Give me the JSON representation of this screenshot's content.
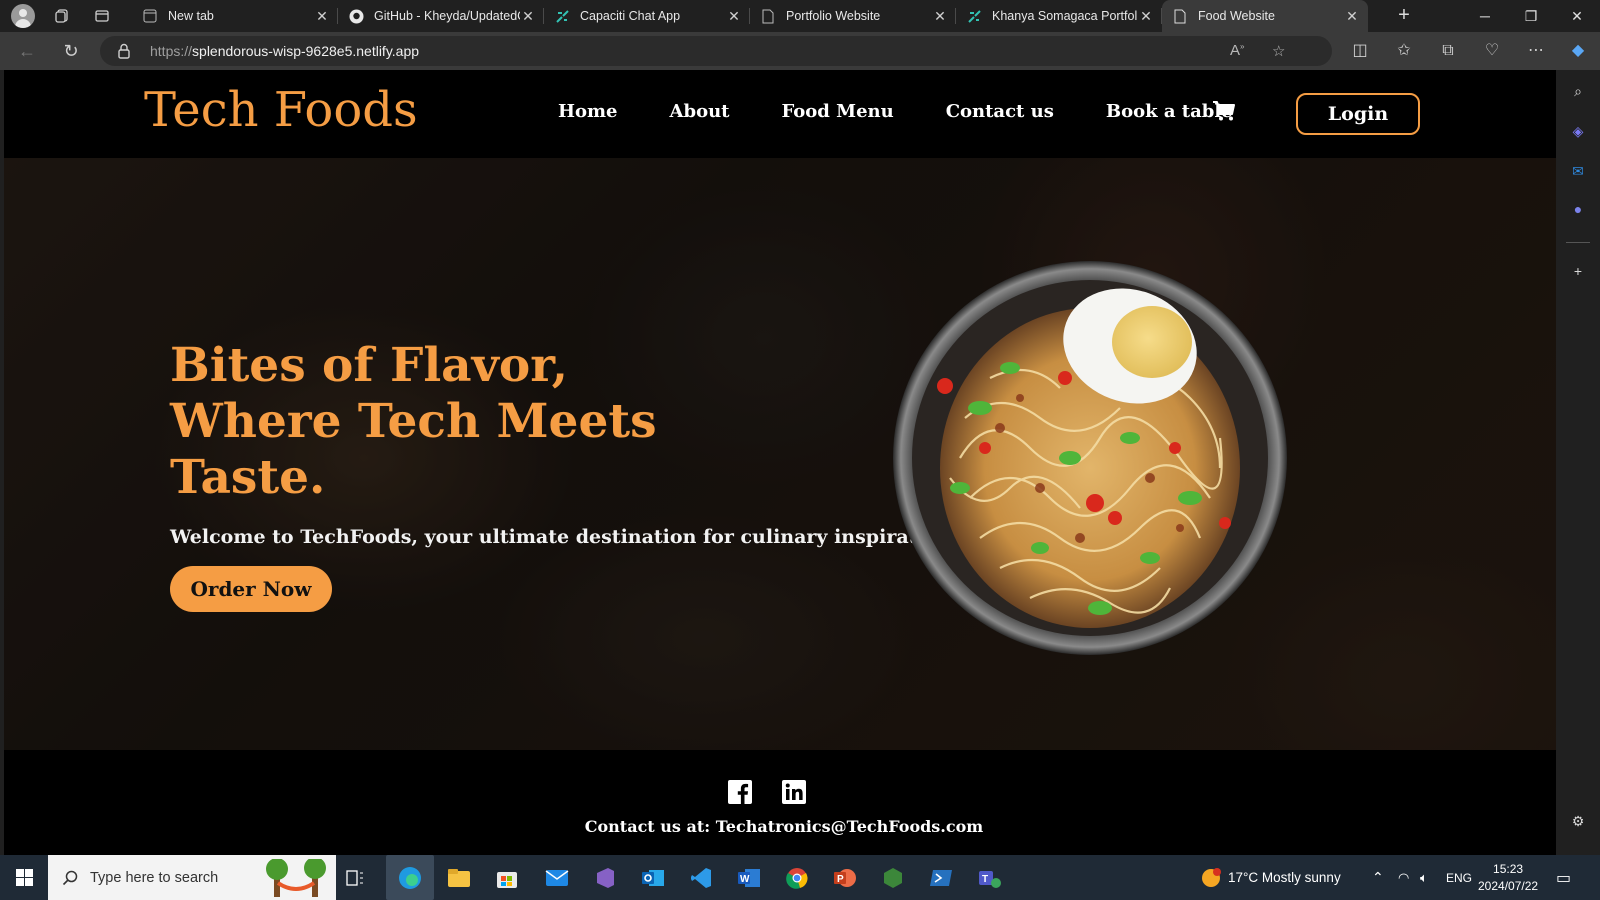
{
  "browser": {
    "tabs": [
      {
        "title": "New tab",
        "icon": "newtab-icon"
      },
      {
        "title": "GitHub - Kheyda/UpdatedC",
        "icon": "github-icon"
      },
      {
        "title": "Capaciti Chat App",
        "icon": "netlify-icon"
      },
      {
        "title": "Portfolio Website",
        "icon": "page-icon"
      },
      {
        "title": "Khanya Somagaca Portfolio",
        "icon": "netlify-icon"
      },
      {
        "title": "Food Website",
        "icon": "page-icon",
        "active": true
      }
    ],
    "address": {
      "scheme": "https://",
      "host": "splendorous-wisp-9628e5.netlify.app"
    }
  },
  "site": {
    "brand": "Tech Foods",
    "nav": [
      "Home",
      "About",
      "Food Menu",
      "Contact us",
      "Book a table"
    ],
    "login_label": "Login",
    "hero": {
      "title": "Bites of Flavor, Where Tech Meets Taste.",
      "subtitle": "Welcome to TechFoods, your ultimate destination for culinary inspiration!",
      "cta": "Order Now"
    },
    "footer": {
      "contact": "Contact us at: Techatronics@TechFoods.com"
    },
    "colors": {
      "accent": "#f59d44",
      "background": "#000000"
    }
  },
  "taskbar": {
    "search_placeholder": "Type here to search",
    "weather": "17°C  Mostly sunny",
    "language": "ENG",
    "time": "15:23",
    "date": "2024/07/22"
  }
}
